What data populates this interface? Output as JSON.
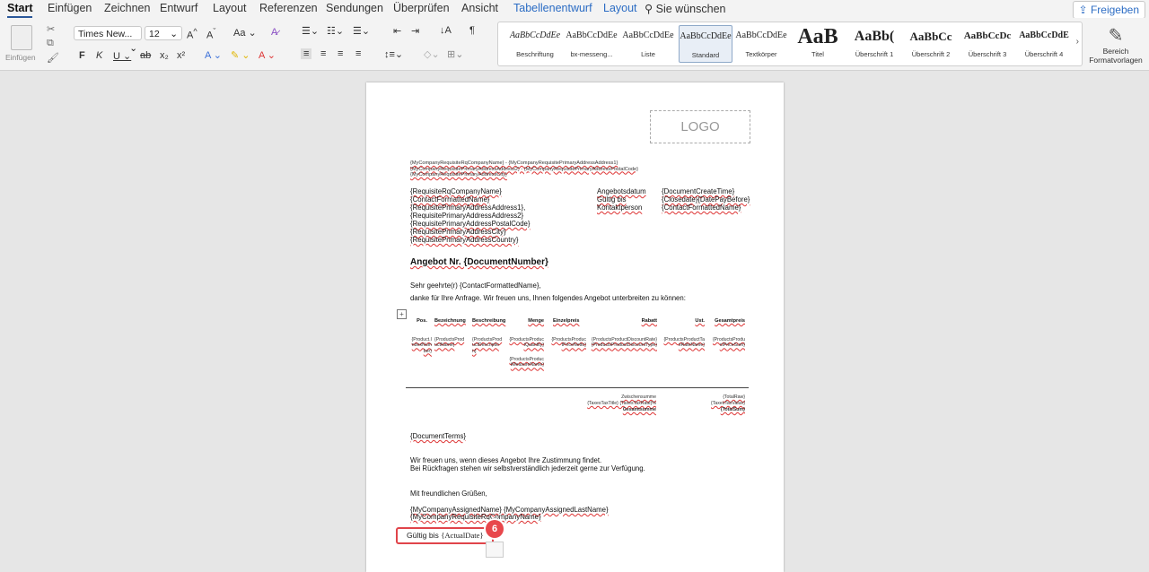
{
  "ribbon_tabs": [
    "Start",
    "Einfügen",
    "Zeichnen",
    "Entwurf",
    "Layout",
    "Referenzen",
    "Sendungen",
    "Überprüfen",
    "Ansicht",
    "Tabellenentwurf",
    "Layout"
  ],
  "tell_me": "Sie wünschen",
  "share": "Freigeben",
  "paste_label": "Einfügen",
  "font_name": "Times New...",
  "font_size": "12",
  "styles": [
    "Beschriftung",
    "bx-messeng...",
    "Liste",
    "Standard",
    "Textkörper",
    "Titel",
    "Überschrift 1",
    "Überschrift 2",
    "Überschrift 3",
    "Überschrift 4"
  ],
  "style_preview": "AaBbCcDdEe",
  "style_preview_titel": "AaB",
  "style_preview_h1": "AaBb(",
  "style_preview_h2": "AaBbCc",
  "style_preview_h3": "AaBbCcDc",
  "style_preview_h4": "AaBbCcDdE",
  "pane_label": "Bereich Formatvorlagen",
  "doc": {
    "logo": "LOGO",
    "sender_line1": "{MyCompanyRequisiteRqCompanyName} - {MyCompanyRequisitePrimaryAddressAddress1}",
    "sender_line2": "{MyCompanyRequisitePrimaryAddressAddress2} - {MyCompanyRequisitePrimaryAddressPostalCode}",
    "sender_line3": "{MyCompanyRequisitePrimaryAddressCity}",
    "recipient": [
      "{RequisiteRqCompanyName}",
      "{ContactFormattedName}",
      "{RequisitePrimaryAddressAddress1},",
      "{RequisitePrimaryAddressAddress2}",
      "{RequisitePrimaryAddressPostalCode}",
      "{RequisitePrimaryAddressCity}",
      "{RequisitePrimaryAddressCountry}"
    ],
    "info_labels": [
      "Angebotsdatum",
      "Gültig bis",
      "Kontaktperson"
    ],
    "info_values": [
      "{DocumentCreateTime}",
      "{Closedate}{DatePayBefore}",
      "{ContactFormattedName}"
    ],
    "heading": "Angebot Nr. {DocumentNumber}",
    "salutation": "Sehr geehrte(r) {ContactFormattedName},",
    "intro": "danke für Ihre Anfrage. Wir freuen uns, Ihnen folgendes Angebot unterbreiten zu können:",
    "table_headers": [
      "Pos.",
      "Bezeichnung",
      "Beschreibung",
      "Menge",
      "Einzelpreis",
      "Rabatt",
      "Ust.",
      "Gesamtpreis"
    ],
    "table_row": [
      "{Product.IndexNumber}",
      "{ProductsProductName}",
      "{ProductsProductDescription}",
      "{ProductsProductQuantity}",
      "{ProductsProductPriceNetto}",
      "{ProductsProductDiscountRate}{ProductsProductDiscountType}",
      "{ProductsProductTaxRateName}",
      "{ProductsProductPriceSum}"
    ],
    "measure": "{ProductsProductMeasureName}",
    "totals_labels": [
      "Zwischensumme",
      "{TaxesTaxTitle} {TaxesTaxRate}%",
      "Gesamtsumme"
    ],
    "totals_values": [
      "{TotalRaw}",
      "{TaxesTaxValue}",
      "{TotalSum}"
    ],
    "terms": "{DocumentTerms}",
    "closing1": "Wir freuen uns, wenn dieses Angebot Ihre Zustimmung findet.",
    "closing2": "Bei Rückfragen stehen wir selbstverständlich jederzeit gerne zur Verfügung.",
    "greeting": "Mit freundlichen Grüßen,",
    "signer": "{MyCompanyAssignedName} {MyCompanyAssignedLastName}",
    "signer_company": "{MyCompanyRequisiteRqCompanyName}",
    "valid_label": "Gültig bis",
    "valid_value": "{ActualDate}"
  },
  "step_badge": "6"
}
